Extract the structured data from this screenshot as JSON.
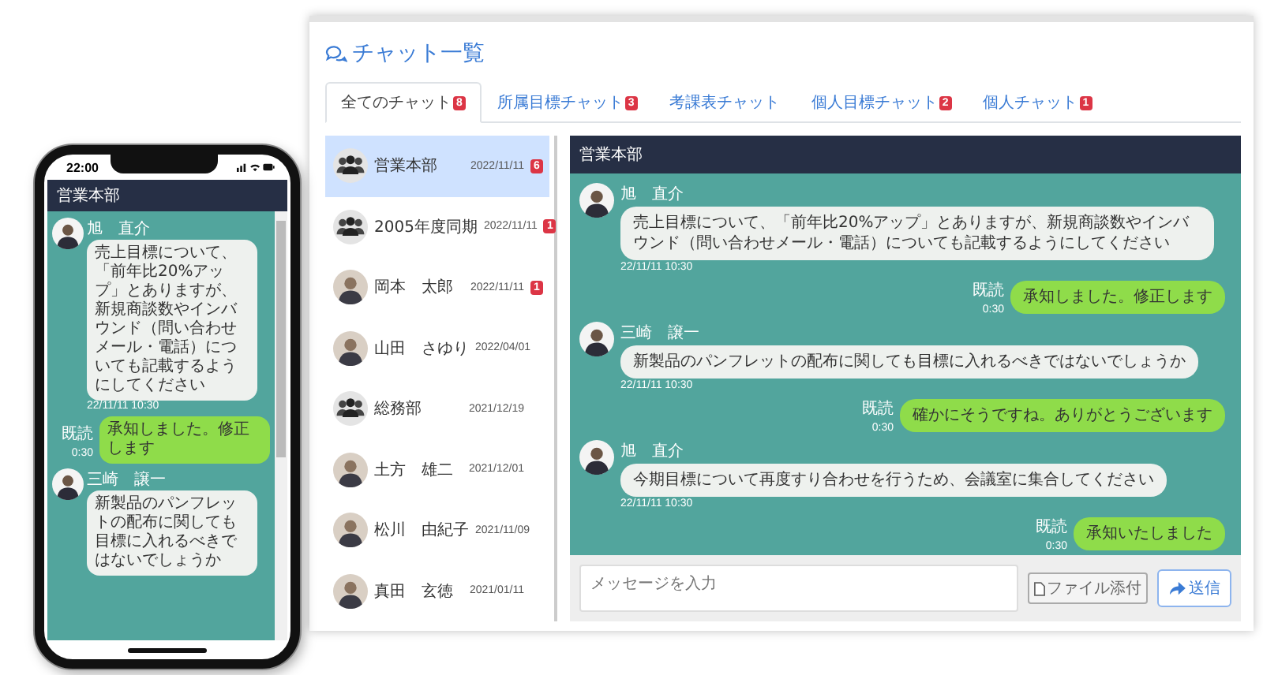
{
  "title": "チャット一覧",
  "tabs": [
    {
      "label": "全てのチャット",
      "badge": "8",
      "selected": true
    },
    {
      "label": "所属目標チャット",
      "badge": "3",
      "selected": false
    },
    {
      "label": "考課表チャット",
      "selected": false
    },
    {
      "label": "個人目標チャット",
      "badge": "2",
      "selected": false
    },
    {
      "label": "個人チャット",
      "badge": "1",
      "selected": false
    }
  ],
  "chats": [
    {
      "kind": "group",
      "name": "営業本部",
      "date": "2022/11/11",
      "badge": "6",
      "selected": true
    },
    {
      "kind": "group",
      "name": "2005年度同期",
      "date": "2022/11/11",
      "badge": "1",
      "selected": false
    },
    {
      "kind": "person",
      "name": "岡本　太郎",
      "date": "2022/11/11",
      "badge": "1",
      "selected": false
    },
    {
      "kind": "person",
      "name": "山田　さゆり",
      "date": "2022/04/01",
      "selected": false
    },
    {
      "kind": "group",
      "name": "総務部",
      "date": "2021/12/19",
      "selected": false
    },
    {
      "kind": "person",
      "name": "土方　雄二",
      "date": "2021/12/01",
      "selected": false
    },
    {
      "kind": "person",
      "name": "松川　由紀子",
      "date": "2021/11/09",
      "selected": false
    },
    {
      "kind": "person",
      "name": "真田　玄徳",
      "date": "2021/01/11",
      "selected": false
    }
  ],
  "room": {
    "title": "営業本部",
    "messages": [
      {
        "kind": "received",
        "sender": "旭　直介",
        "text": "売上目標について、「前年比20%アップ」とありますが、新規商談数やインバウンド（問い合わせメール・電話）についても記載するようにしてください",
        "time": "22/11/11 10:30"
      },
      {
        "kind": "sent",
        "status": "既読",
        "time": "0:30",
        "text": "承知しました。修正します"
      },
      {
        "kind": "received",
        "sender": "三崎　譲一",
        "text": "新製品のパンフレットの配布に関しても目標に入れるべきではないでしょうか",
        "time": "22/11/11 10:30"
      },
      {
        "kind": "sent",
        "status": "既読",
        "time": "0:30",
        "text": "確かにそうですね。ありがとうございます"
      },
      {
        "kind": "received",
        "sender": "旭　直介",
        "text": "今期目標について再度すり合わせを行うため、会議室に集合してください",
        "time": "22/11/11 10:30"
      },
      {
        "kind": "sent",
        "status": "既読",
        "time": "0:30",
        "text": "承知いたしました"
      }
    ]
  },
  "composer": {
    "placeholder": "メッセージを入力",
    "attach": "ファイル添付",
    "send": "送信"
  },
  "phone": {
    "time": "22:00",
    "title": "営業本部",
    "messages": [
      {
        "kind": "received",
        "sender": "旭　直介",
        "text": "売上目標について、「前年比20%アップ」とありますが、新規商談数やインバウンド（問い合わせメール・電話）についても記載するようにしてください",
        "time": "22/11/11 10:30"
      },
      {
        "kind": "sent",
        "status": "既読",
        "time": "0:30",
        "text": "承知しました。修正します"
      },
      {
        "kind": "received",
        "sender": "三崎　譲一",
        "text": "新製品のパンフレットの配布に関しても目標に入れるべきではないでしょうか"
      }
    ]
  }
}
